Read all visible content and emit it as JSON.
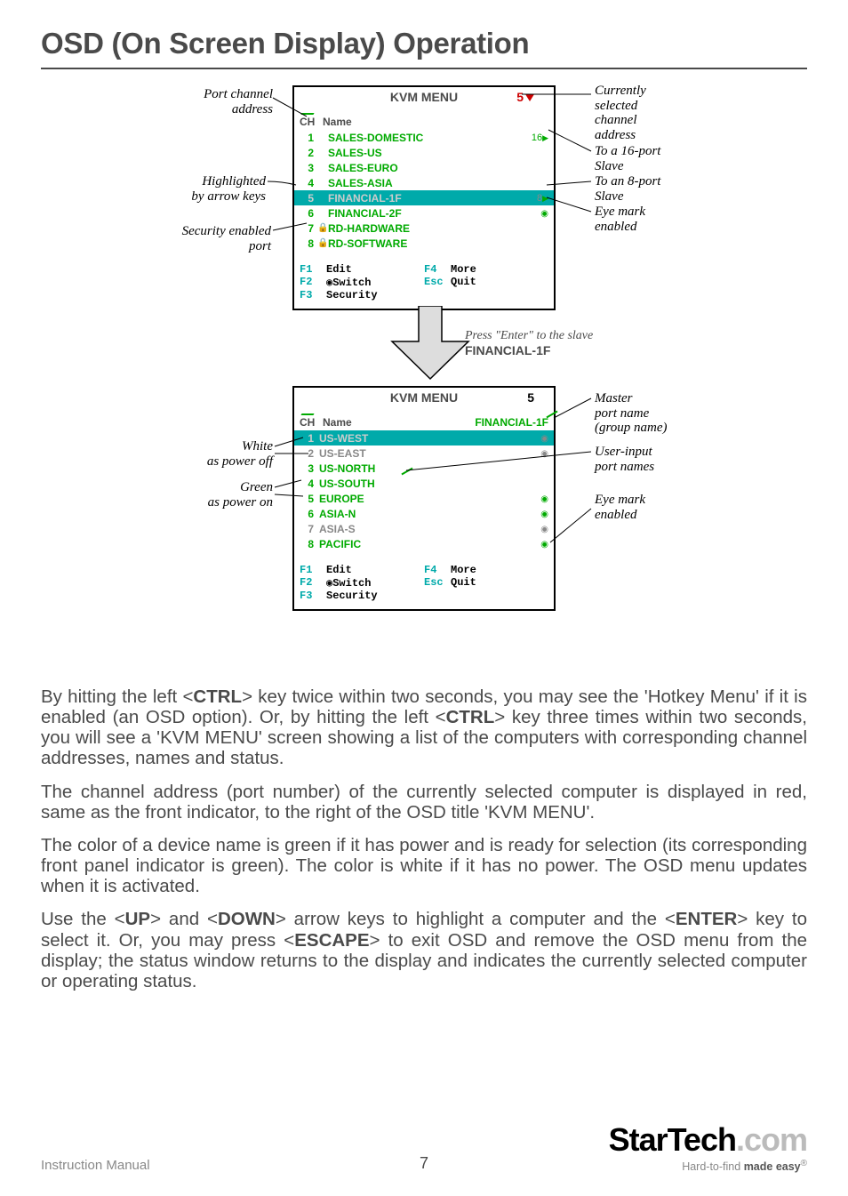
{
  "title": "OSD (On Screen Display) Operation",
  "menu1": {
    "title": "KVM MENU",
    "current": "5",
    "colCh": "CH",
    "colName": "Name",
    "rows": [
      {
        "ch": "1",
        "lock": "",
        "name": "SALES-DOMESTIC",
        "ind": "16▶",
        "cls": "green",
        "hl": false
      },
      {
        "ch": "2",
        "lock": "",
        "name": "SALES-US",
        "ind": "",
        "cls": "green",
        "hl": false
      },
      {
        "ch": "3",
        "lock": "",
        "name": "SALES-EURO",
        "ind": "",
        "cls": "green",
        "hl": false
      },
      {
        "ch": "4",
        "lock": "",
        "name": "SALES-ASIA",
        "ind": "",
        "cls": "green",
        "hl": false
      },
      {
        "ch": "5",
        "lock": "",
        "name": "FINANCIAL-1F",
        "ind": "8▶",
        "cls": "white",
        "hl": true
      },
      {
        "ch": "6",
        "lock": "",
        "name": "FINANCIAL-2F",
        "ind": "◉",
        "cls": "green",
        "hl": false
      },
      {
        "ch": "7",
        "lock": "🔒",
        "name": "RD-HARDWARE",
        "ind": "",
        "cls": "green",
        "hl": false
      },
      {
        "ch": "8",
        "lock": "🔒",
        "name": "RD-SOFTWARE",
        "ind": "",
        "cls": "green",
        "hl": false
      }
    ],
    "fn": {
      "f1": "F1",
      "f1l": "Edit",
      "f2": "F2",
      "f2l": "◉Switch",
      "f3": "F3",
      "f3l": "Security",
      "f4": "F4",
      "f4l": "More",
      "esc": "Esc",
      "escl": "Quit"
    }
  },
  "arrowNote": {
    "line1": "Press \"Enter\" to the slave",
    "line2": "FINANCIAL-1F"
  },
  "menu2": {
    "title": "KVM MENU",
    "current": "5",
    "colCh": "CH",
    "colName": "Name",
    "group": "FINANCIAL-1F",
    "rows": [
      {
        "ch": "1",
        "name": "US-WEST",
        "ind": "◉",
        "cls": "white",
        "hl": true
      },
      {
        "ch": "2",
        "name": "US-EAST",
        "ind": "◉",
        "cls": "white",
        "hl": false
      },
      {
        "ch": "3",
        "name": "US-NORTH",
        "ind": "",
        "cls": "green",
        "hl": false
      },
      {
        "ch": "4",
        "name": "US-SOUTH",
        "ind": "",
        "cls": "green",
        "hl": false
      },
      {
        "ch": "5",
        "name": "EUROPE",
        "ind": "◉",
        "cls": "green",
        "hl": false
      },
      {
        "ch": "6",
        "name": "ASIA-N",
        "ind": "◉",
        "cls": "green",
        "hl": false
      },
      {
        "ch": "7",
        "name": "ASIA-S",
        "ind": "◉",
        "cls": "white",
        "hl": false
      },
      {
        "ch": "8",
        "name": "PACIFIC",
        "ind": "◉",
        "cls": "green",
        "hl": false
      }
    ],
    "fn": {
      "f1": "F1",
      "f1l": "Edit",
      "f2": "F2",
      "f2l": "◉Switch",
      "f3": "F3",
      "f3l": "Security",
      "f4": "F4",
      "f4l": "More",
      "esc": "Esc",
      "escl": "Quit"
    }
  },
  "labels": {
    "portChannel": "Port channel\naddress",
    "highlighted": "Highlighted\nby arrow keys",
    "security": "Security enabled\nport",
    "currently": "Currently\nselected\nchannel\naddress",
    "to16": "To a 16-port\nSlave",
    "to8": "To an 8-port\nSlave",
    "eyeMark1": "Eye mark\nenabled",
    "master": "Master\nport name\n(group name)",
    "whiteOff": "White\nas power off",
    "greenOn": "Green\nas power on",
    "userInput": "User-input\nport names",
    "eyeMark2": "Eye mark\nenabled"
  },
  "paragraphs": {
    "p1a": "By hitting the left <",
    "p1b": "CTRL",
    "p1c": "> key twice within two seconds, you may see the 'Hotkey Menu' if it is enabled (an OSD option). Or, by hitting the left <",
    "p1d": "CTRL",
    "p1e": "> key three times within two seconds, you will see a 'KVM MENU' screen showing a list of the computers with corresponding channel addresses, names and status.",
    "p2": "The channel address (port number) of the currently selected computer is displayed in red, same as the front indicator, to the right of the OSD title 'KVM MENU'.",
    "p3": "The color of a device name is green if it has power and is ready for selection (its corresponding front panel indicator is green). The color is white if it has no power. The OSD menu updates when it is activated.",
    "p4a": "Use the <",
    "p4b": "UP",
    "p4c": "> and <",
    "p4d": "DOWN",
    "p4e": "> arrow keys to highlight a computer and the <",
    "p4f": "ENTER",
    "p4g": "> key to select it. Or, you may press <",
    "p4h": "ESCAPE",
    "p4i": "> to exit OSD and remove the OSD menu from the display; the status window returns to the display and indicates the currently selected computer or operating status."
  },
  "footer": {
    "instruction": "Instruction Manual",
    "page": "7",
    "logo1": "Star",
    "logo2": "Tech",
    "logo3": ".com",
    "tagline1": "Hard-to-find ",
    "tagline2": "made easy"
  }
}
